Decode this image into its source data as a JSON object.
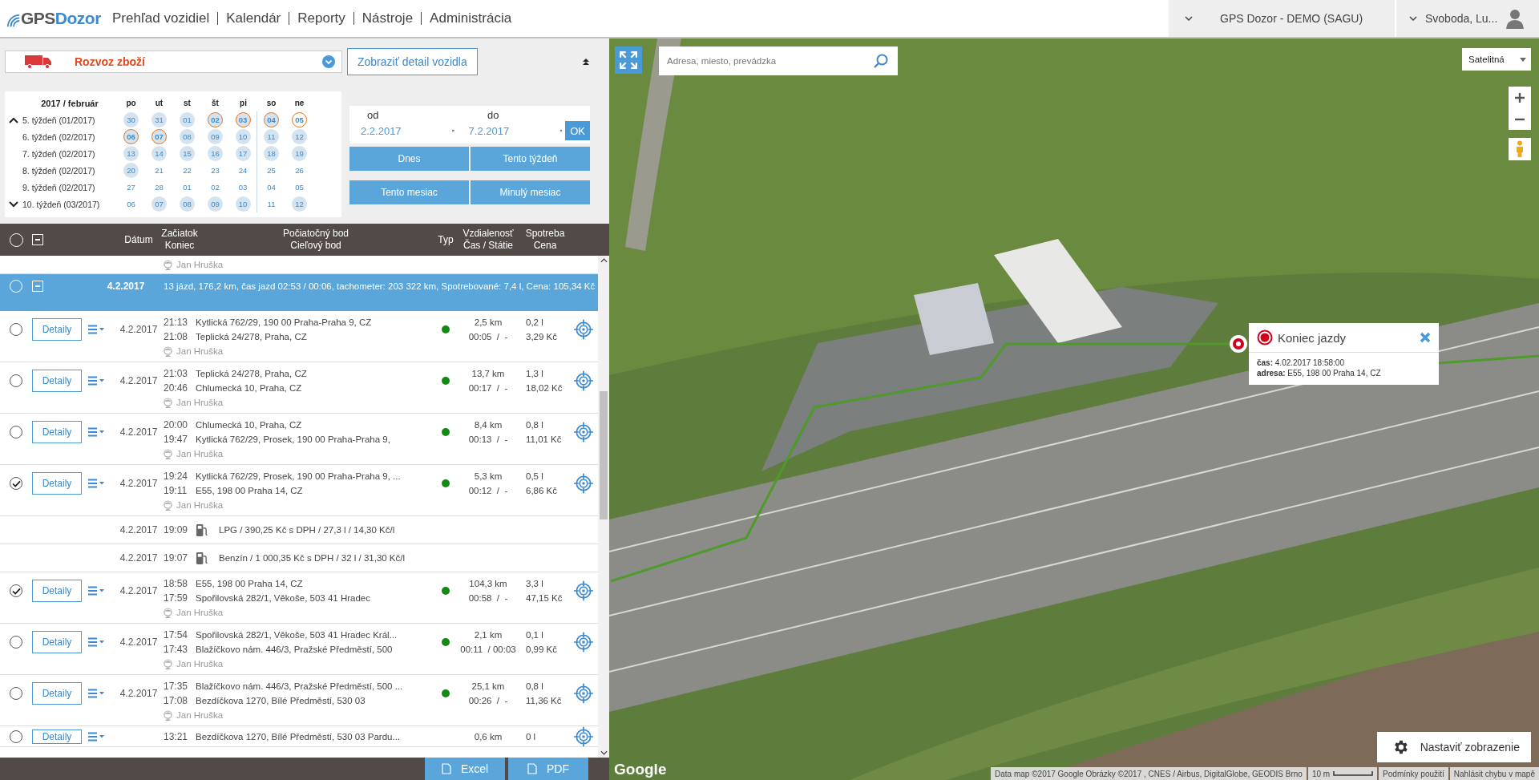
{
  "header": {
    "logo_left": "GPS",
    "logo_right": "Dozor",
    "nav": [
      "Prehľad vozidiel",
      "Kalendár",
      "Reporty",
      "Nástroje",
      "Administrácia"
    ],
    "account": "GPS Dozor - DEMO (SAGU)",
    "user": "Svoboda, Lu..."
  },
  "vehicle": {
    "name": "Rozvoz zboží",
    "detail_button": "Zobraziť detail vozidla"
  },
  "calendar": {
    "title": "2017 / február",
    "weekdays": [
      "po",
      "ut",
      "st",
      "št",
      "pi",
      "so",
      "ne"
    ],
    "weeks": [
      {
        "label": "5. týždeň (01/2017)",
        "days": [
          {
            "day": "30",
            "marked": true,
            "selected": false
          },
          {
            "day": "31",
            "marked": true,
            "selected": false
          },
          {
            "day": "01",
            "marked": true,
            "selected": false
          },
          {
            "day": "02",
            "marked": true,
            "selected": true
          },
          {
            "day": "03",
            "marked": true,
            "selected": true
          },
          {
            "day": "04",
            "marked": true,
            "selected": true
          },
          {
            "day": "05",
            "marked": false,
            "selected": true
          }
        ]
      },
      {
        "label": "6. týždeň (02/2017)",
        "days": [
          {
            "day": "06",
            "marked": true,
            "selected": true
          },
          {
            "day": "07",
            "marked": true,
            "selected": true
          },
          {
            "day": "08",
            "marked": true,
            "selected": false
          },
          {
            "day": "09",
            "marked": true,
            "selected": false
          },
          {
            "day": "10",
            "marked": true,
            "selected": false
          },
          {
            "day": "11",
            "marked": true,
            "selected": false
          },
          {
            "day": "12",
            "marked": true,
            "selected": false
          }
        ]
      },
      {
        "label": "7. týždeň (02/2017)",
        "days": [
          {
            "day": "13",
            "marked": true,
            "selected": false
          },
          {
            "day": "14",
            "marked": true,
            "selected": false
          },
          {
            "day": "15",
            "marked": true,
            "selected": false
          },
          {
            "day": "16",
            "marked": true,
            "selected": false
          },
          {
            "day": "17",
            "marked": true,
            "selected": false
          },
          {
            "day": "18",
            "marked": true,
            "selected": false
          },
          {
            "day": "19",
            "marked": true,
            "selected": false
          }
        ]
      },
      {
        "label": "8. týždeň (02/2017)",
        "days": [
          {
            "day": "20",
            "marked": true,
            "selected": false
          },
          {
            "day": "21",
            "marked": false,
            "selected": false
          },
          {
            "day": "22",
            "marked": false,
            "selected": false
          },
          {
            "day": "23",
            "marked": false,
            "selected": false
          },
          {
            "day": "24",
            "marked": false,
            "selected": false
          },
          {
            "day": "25",
            "marked": false,
            "selected": false
          },
          {
            "day": "26",
            "marked": false,
            "selected": false
          }
        ]
      },
      {
        "label": "9. týždeň (02/2017)",
        "days": [
          {
            "day": "27",
            "marked": false,
            "selected": false
          },
          {
            "day": "28",
            "marked": false,
            "selected": false
          },
          {
            "day": "01",
            "marked": false,
            "selected": false
          },
          {
            "day": "02",
            "marked": false,
            "selected": false
          },
          {
            "day": "03",
            "marked": false,
            "selected": false
          },
          {
            "day": "04",
            "marked": false,
            "selected": false
          },
          {
            "day": "05",
            "marked": false,
            "selected": false
          }
        ]
      },
      {
        "label": "10. týždeň (03/2017)",
        "days": [
          {
            "day": "06",
            "marked": false,
            "selected": false
          },
          {
            "day": "07",
            "marked": true,
            "selected": false
          },
          {
            "day": "08",
            "marked": true,
            "selected": false
          },
          {
            "day": "09",
            "marked": true,
            "selected": false
          },
          {
            "day": "10",
            "marked": true,
            "selected": false
          },
          {
            "day": "11",
            "marked": false,
            "selected": false
          },
          {
            "day": "12",
            "marked": true,
            "selected": false
          }
        ]
      }
    ]
  },
  "range": {
    "from_label": "od",
    "to_label": "do",
    "from": "2.2.2017",
    "to": "7.2.2017",
    "ok": "OK",
    "quick": [
      "Dnes",
      "Tento týždeň",
      "Tento mesiac",
      "Minulý mesiac"
    ]
  },
  "table": {
    "columns": [
      [
        "Dátum"
      ],
      [
        "Začiatok",
        "Koniec"
      ],
      [
        "Počiatočný bod",
        "Cieľový bod"
      ],
      [
        "Typ"
      ],
      [
        "Vzdialenosť",
        "Čas / Státie"
      ],
      [
        "Spotreba",
        "Cena"
      ]
    ],
    "select_all": false,
    "expanded_all": true,
    "rows": [
      {
        "kind": "driver",
        "driver": "Jan Hruška"
      },
      {
        "kind": "day",
        "checked": false,
        "expanded": true,
        "date": "4.2.2017",
        "summary": "13 jázd, 176,2 km, čas jazd 02:53 / 00:06, tachometer: 203 322 km, Spotrebované: 7,4 l, Cena: 105,34 Kč"
      },
      {
        "kind": "trip",
        "checked": false,
        "detail": "Detaily",
        "date": "4.2.2017",
        "start": "21:13",
        "end": "21:08",
        "from": "Kytlická 762/29, 190 00 Praha-Praha 9, CZ",
        "to": "Teplická 24/278, Praha, CZ",
        "driver": "Jan Hruška",
        "color": "#138a13",
        "distance": "2,5 km",
        "duration": "00:05  /  -",
        "fuel": "0,2 l",
        "price": "3,29 Kč"
      },
      {
        "kind": "trip",
        "checked": false,
        "detail": "Detaily",
        "date": "4.2.2017",
        "start": "21:03",
        "end": "20:46",
        "from": "Teplická 24/278, Praha, CZ",
        "to": "Chlumecká 10, Praha, CZ",
        "driver": "Jan Hruška",
        "color": "#138a13",
        "distance": "13,7 km",
        "duration": "00:17  /  -",
        "fuel": "1,3 l",
        "price": "18,02 Kč"
      },
      {
        "kind": "trip",
        "checked": false,
        "detail": "Detaily",
        "date": "4.2.2017",
        "start": "20:00",
        "end": "19:47",
        "from": "Chlumecká 10, Praha, CZ",
        "to": "Kytlická 762/29, Prosek, 190 00 Praha-Praha 9,",
        "driver": "Jan Hruška",
        "color": "#138a13",
        "distance": "8,4 km",
        "duration": "00:13  /  -",
        "fuel": "0,8 l",
        "price": "11,01 Kč"
      },
      {
        "kind": "trip",
        "checked": true,
        "detail": "Detaily",
        "date": "4.2.2017",
        "start": "19:24",
        "end": "19:11",
        "from": "Kytlická 762/29, Prosek, 190 00 Praha-Praha 9, ...",
        "to": "E55, 198 00 Praha 14, CZ",
        "driver": "Jan Hruška",
        "color": "#138a13",
        "distance": "5,3 km",
        "duration": "00:12  /  -",
        "fuel": "0,5 l",
        "price": "6,86 Kč"
      },
      {
        "kind": "fuel",
        "date": "4.2.2017",
        "time": "19:09",
        "text": "LPG / 390,25 Kč s DPH / 27,3 l / 14,30 Kč/l"
      },
      {
        "kind": "fuel",
        "date": "4.2.2017",
        "time": "19:07",
        "text": "Benzín / 1 000,35 Kč s DPH / 32 l / 31,30 Kč/l"
      },
      {
        "kind": "trip",
        "checked": true,
        "detail": "Detaily",
        "date": "4.2.2017",
        "start": "18:58",
        "end": "17:59",
        "from": "E55, 198 00 Praha 14, CZ",
        "to": "Spořilovská 282/1, Věkoše, 503 41 Hradec",
        "driver": "Jan Hruška",
        "color": "#138a13",
        "distance": "104,3 km",
        "duration": "00:58  /  -",
        "fuel": "3,3 l",
        "price": "47,15 Kč"
      },
      {
        "kind": "trip",
        "checked": false,
        "detail": "Detaily",
        "date": "4.2.2017",
        "start": "17:54",
        "end": "17:43",
        "from": "Spořilovská 282/1, Věkoše, 503 41 Hradec Král...",
        "to": "Blažíčkovo nám. 446/3, Pražské Předměstí, 500",
        "driver": "Jan Hruška",
        "color": "#138a13",
        "distance": "2,1 km",
        "duration": "00:11  / 00:03",
        "fuel": "0,1 l",
        "price": "0,99 Kč"
      },
      {
        "kind": "trip",
        "checked": false,
        "detail": "Detaily",
        "date": "4.2.2017",
        "start": "17:35",
        "end": "17:08",
        "from": "Blažíčkovo nám. 446/3, Pražské Předměstí, 500 ...",
        "to": "Bezdíčkova 1270, Bílé Předměstí, 530 03",
        "driver": "Jan Hruška",
        "color": "#138a13",
        "distance": "25,1 km",
        "duration": "00:26  /  -",
        "fuel": "0,8 l",
        "price": "11,36 Kč"
      },
      {
        "kind": "cut",
        "checked": false,
        "detail": "Detaily",
        "start": "13:21",
        "from": "Bezdíčkova 1270, Bílé Předměstí, 530 03 Pardu...",
        "distance": "0,6 km",
        "fuel": "0 l"
      }
    ]
  },
  "export": [
    "Excel",
    "PDF"
  ],
  "map": {
    "search_placeholder": "Adresa, miesto, prevádzka",
    "map_type": "Satelitná",
    "popup": {
      "title": "Koniec jazdy",
      "lines": [
        "**čas:** 4.02.2017 18:58:00",
        "**adresa:** E55, 198 00 Praha 14, CZ"
      ]
    },
    "settings_button": "Nastaviť zobrazenie",
    "brand": "Google",
    "attribution": "Data map ©2017 Google Obrázky ©2017 , CNES / Airbus, DigitalGlobe, GEODIS Brno",
    "scale": "10 m",
    "terms": "Podmínky použití",
    "report": "Nahlásit chybu v mapě"
  }
}
